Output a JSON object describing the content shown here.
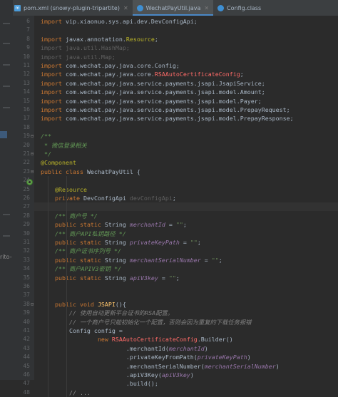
{
  "tabs": [
    {
      "label": "pom.xml (snowy-plugin-tripartite)",
      "icon": "maven-icon",
      "active": false
    },
    {
      "label": "WechatPayUtil.java",
      "icon": "class-icon",
      "active": true
    },
    {
      "label": "Config.class",
      "icon": "class-icon",
      "active": false
    }
  ],
  "side_label": "rito-",
  "lines": [
    {
      "n": "6",
      "segs": [
        [
          "k",
          "import "
        ],
        [
          "",
          "vip.xiaonuo.sys.api.dev.DevConfigApi;"
        ]
      ]
    },
    {
      "n": "7",
      "segs": []
    },
    {
      "n": "8",
      "segs": [
        [
          "k",
          "import "
        ],
        [
          "",
          "javax.annotation."
        ],
        [
          "a",
          "Resource"
        ],
        [
          "",
          ";"
        ]
      ]
    },
    {
      "n": "9",
      "segs": [
        [
          "d",
          "import java.util.HashMap;"
        ]
      ]
    },
    {
      "n": "10",
      "segs": [
        [
          "d",
          "import java.util.Map;"
        ]
      ]
    },
    {
      "n": "11",
      "segs": [
        [
          "k",
          "import "
        ],
        [
          "",
          "com.wechat.pay.java.core.Config;"
        ]
      ]
    },
    {
      "n": "12",
      "segs": [
        [
          "k",
          "import "
        ],
        [
          "",
          "com.wechat.pay.java.core."
        ],
        [
          "r",
          "RSAAutoCertificateConfig"
        ],
        [
          "",
          ";"
        ]
      ]
    },
    {
      "n": "13",
      "segs": [
        [
          "k",
          "import "
        ],
        [
          "",
          "com.wechat.pay.java.service.payments.jsapi.JsapiService;"
        ]
      ]
    },
    {
      "n": "14",
      "segs": [
        [
          "k",
          "import "
        ],
        [
          "",
          "com.wechat.pay.java.service.payments.jsapi.model.Amount;"
        ]
      ]
    },
    {
      "n": "15",
      "segs": [
        [
          "k",
          "import "
        ],
        [
          "",
          "com.wechat.pay.java.service.payments.jsapi.model.Payer;"
        ]
      ]
    },
    {
      "n": "16",
      "segs": [
        [
          "k",
          "import "
        ],
        [
          "",
          "com.wechat.pay.java.service.payments.jsapi.model.PrepayRequest;"
        ]
      ]
    },
    {
      "n": "17",
      "segs": [
        [
          "k",
          "import "
        ],
        [
          "",
          "com.wechat.pay.java.service.payments.jsapi.model.PrepayResponse;"
        ]
      ]
    },
    {
      "n": "18",
      "segs": []
    },
    {
      "n": "19",
      "segs": [
        [
          "dc",
          "/**"
        ]
      ]
    },
    {
      "n": "20",
      "segs": [
        [
          "dc",
          " * 微信登录相关"
        ]
      ]
    },
    {
      "n": "21",
      "segs": [
        [
          "dc",
          " */"
        ]
      ]
    },
    {
      "n": "22",
      "segs": [
        [
          "a",
          "@Component"
        ]
      ]
    },
    {
      "n": "23",
      "segs": [
        [
          "k",
          "public class "
        ],
        [
          "",
          "WechatPayUtil {"
        ]
      ]
    },
    {
      "n": "24",
      "segs": []
    },
    {
      "n": "25",
      "segs": [
        [
          "",
          "    "
        ],
        [
          "a",
          "@Resource"
        ]
      ]
    },
    {
      "n": "26",
      "segs": [
        [
          "",
          "    "
        ],
        [
          "k",
          "private "
        ],
        [
          "",
          "DevConfigApi "
        ],
        [
          "d",
          "devConfigApi"
        ],
        [
          "",
          ";"
        ]
      ]
    },
    {
      "n": "27",
      "segs": []
    },
    {
      "n": "28",
      "segs": [
        [
          "",
          "    "
        ],
        [
          "dc",
          "/** 商户号 */"
        ]
      ]
    },
    {
      "n": "29",
      "segs": [
        [
          "",
          "    "
        ],
        [
          "k",
          "public static "
        ],
        [
          "",
          "String "
        ],
        [
          "f",
          "merchantId"
        ],
        [
          "",
          " = "
        ],
        [
          "s",
          "\"\""
        ],
        [
          "",
          ";"
        ]
      ]
    },
    {
      "n": "30",
      "segs": [
        [
          "",
          "    "
        ],
        [
          "dc",
          "/** 商户API私钥路径 */"
        ]
      ]
    },
    {
      "n": "31",
      "segs": [
        [
          "",
          "    "
        ],
        [
          "k",
          "public static "
        ],
        [
          "",
          "String "
        ],
        [
          "f",
          "privateKeyPath"
        ],
        [
          "",
          " = "
        ],
        [
          "s",
          "\"\""
        ],
        [
          "",
          ";"
        ]
      ]
    },
    {
      "n": "32",
      "segs": [
        [
          "",
          "    "
        ],
        [
          "dc",
          "/** 商户证书序列号 */"
        ]
      ]
    },
    {
      "n": "33",
      "segs": [
        [
          "",
          "    "
        ],
        [
          "k",
          "public static "
        ],
        [
          "",
          "String "
        ],
        [
          "f",
          "merchantSerialNumber"
        ],
        [
          "",
          " = "
        ],
        [
          "s",
          "\"\""
        ],
        [
          "",
          ";"
        ]
      ]
    },
    {
      "n": "34",
      "segs": [
        [
          "",
          "    "
        ],
        [
          "dc",
          "/** 商户APIV3密钥 */"
        ]
      ]
    },
    {
      "n": "35",
      "segs": [
        [
          "",
          "    "
        ],
        [
          "k",
          "public static "
        ],
        [
          "",
          "String "
        ],
        [
          "f",
          "apiV3key"
        ],
        [
          "",
          " = "
        ],
        [
          "s",
          "\"\""
        ],
        [
          "",
          ";"
        ]
      ]
    },
    {
      "n": "36",
      "segs": []
    },
    {
      "n": "37",
      "segs": []
    },
    {
      "n": "38",
      "segs": [
        [
          "",
          "    "
        ],
        [
          "k",
          "public void "
        ],
        [
          "mth",
          "JSAPI"
        ],
        [
          "",
          "(){"
        ]
      ]
    },
    {
      "n": "39",
      "segs": [
        [
          "",
          "        "
        ],
        [
          "cm",
          "// 使用自动更新平台证书的RSA配置。"
        ]
      ]
    },
    {
      "n": "40",
      "segs": [
        [
          "",
          "        "
        ],
        [
          "cm",
          "// 一个商户号只能初始化一个配置，否则会因为重复的下载任务报错"
        ]
      ]
    },
    {
      "n": "41",
      "segs": [
        [
          "",
          "        Config config ="
        ]
      ]
    },
    {
      "n": "42",
      "segs": [
        [
          "",
          "                "
        ],
        [
          "k",
          "new "
        ],
        [
          "r",
          "RSAAutoCertificateConfig"
        ],
        [
          "",
          ".Builder()"
        ]
      ]
    },
    {
      "n": "43",
      "segs": [
        [
          "",
          "                        .merchantId("
        ],
        [
          "f",
          "merchantId"
        ],
        [
          "",
          ")"
        ]
      ]
    },
    {
      "n": "44",
      "segs": [
        [
          "",
          "                        .privateKeyFromPath("
        ],
        [
          "f",
          "privateKeyPath"
        ],
        [
          "",
          ")"
        ]
      ]
    },
    {
      "n": "45",
      "segs": [
        [
          "",
          "                        .merchantSerialNumber("
        ],
        [
          "f",
          "merchantSerialNumber"
        ],
        [
          "",
          ")"
        ]
      ]
    },
    {
      "n": "46",
      "segs": [
        [
          "",
          "                        .apiV3Key("
        ],
        [
          "f",
          "apiV3key"
        ],
        [
          "",
          ")"
        ]
      ]
    },
    {
      "n": "47",
      "segs": [
        [
          "",
          "                        .build();"
        ]
      ]
    },
    {
      "n": "48",
      "segs": [
        [
          "gi",
          "        // ..."
        ]
      ]
    }
  ]
}
